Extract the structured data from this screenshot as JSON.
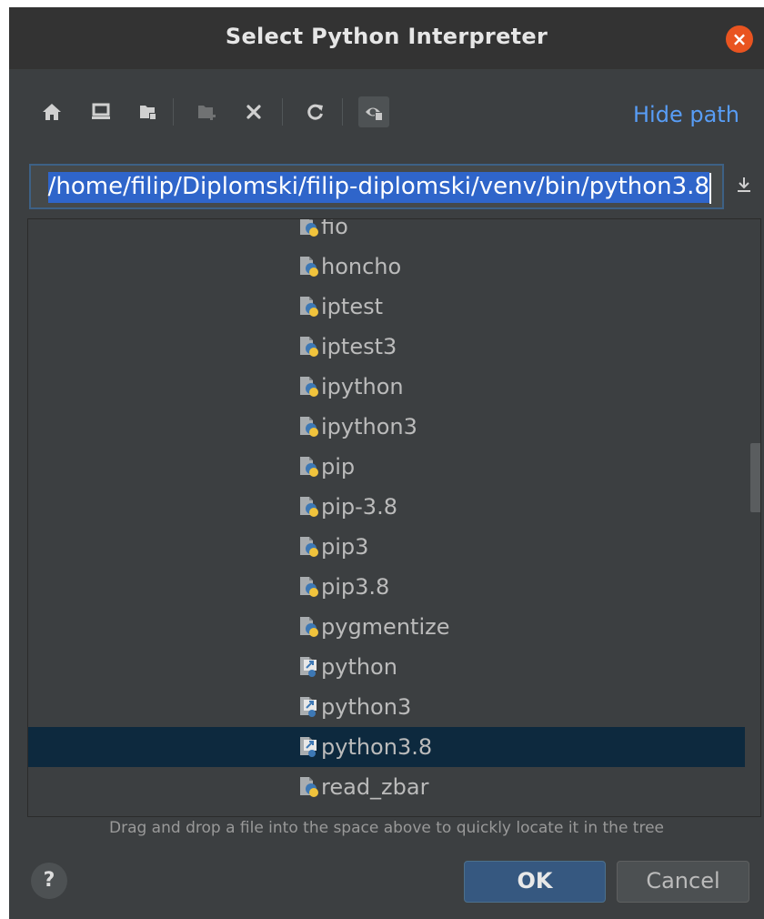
{
  "dialog": {
    "title": "Select Python Interpreter",
    "close_glyph": "×"
  },
  "toolbar": {
    "buttons": [
      {
        "name": "home-icon",
        "enabled": true
      },
      {
        "name": "desktop-icon",
        "enabled": true
      },
      {
        "name": "project-folder-icon",
        "enabled": true
      },
      {
        "name": "new-folder-icon",
        "enabled": false
      },
      {
        "name": "delete-icon",
        "enabled": true
      },
      {
        "name": "refresh-icon",
        "enabled": true
      },
      {
        "name": "show-hidden-files-icon",
        "enabled": true,
        "active": true
      }
    ],
    "hide_path_label": "Hide path"
  },
  "path": {
    "value": "/home/filip/Diplomski/filip-diplomski/venv/bin/python3.8"
  },
  "tree": {
    "items": [
      {
        "label": "fio",
        "icon": "python-script-icon"
      },
      {
        "label": "honcho",
        "icon": "python-script-icon"
      },
      {
        "label": "iptest",
        "icon": "python-script-icon"
      },
      {
        "label": "iptest3",
        "icon": "python-script-icon"
      },
      {
        "label": "ipython",
        "icon": "python-script-icon"
      },
      {
        "label": "ipython3",
        "icon": "python-script-icon"
      },
      {
        "label": "pip",
        "icon": "python-script-icon"
      },
      {
        "label": "pip-3.8",
        "icon": "python-script-icon"
      },
      {
        "label": "pip3",
        "icon": "python-script-icon"
      },
      {
        "label": "pip3.8",
        "icon": "python-script-icon"
      },
      {
        "label": "pygmentize",
        "icon": "python-script-icon"
      },
      {
        "label": "python",
        "icon": "python-symlink-icon"
      },
      {
        "label": "python3",
        "icon": "python-symlink-icon"
      },
      {
        "label": "python3.8",
        "icon": "python-symlink-icon",
        "selected": true
      },
      {
        "label": "read_zbar",
        "icon": "python-script-icon"
      }
    ]
  },
  "hint": "Drag and drop a file into the space above to quickly locate it in the tree",
  "buttons": {
    "help_label": "?",
    "ok_label": "OK",
    "cancel_label": "Cancel"
  },
  "colors": {
    "background": "#3c3f41",
    "selection": "#0d293e",
    "accent_link": "#589df6",
    "primary_button": "#365880",
    "close_button": "#e95420"
  }
}
